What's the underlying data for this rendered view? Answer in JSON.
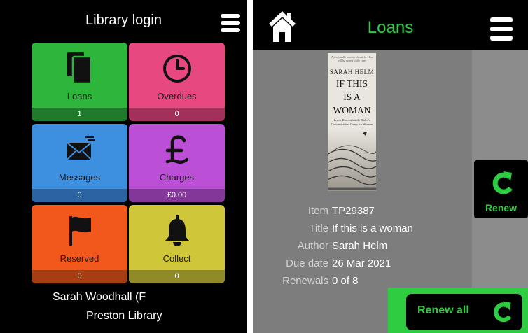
{
  "left_panel": {
    "title": "Library login",
    "tiles": {
      "loans": {
        "label": "Loans",
        "count": "1"
      },
      "overdues": {
        "label": "Overdues",
        "count": "0"
      },
      "messages": {
        "label": "Messages",
        "count": "0"
      },
      "charges": {
        "label": "Charges",
        "count": "£0.00"
      },
      "reserved": {
        "label": "Reserved",
        "count": "0"
      },
      "collect": {
        "label": "Collect",
        "count": "0"
      }
    },
    "user_name": "Sarah Woodhall (F",
    "library_name": "Preston Library"
  },
  "right_panel": {
    "title": "Loans",
    "cover": {
      "quote": "'A profoundly moving chronicle... You will be moved to the core'",
      "author": "SARAH HELM",
      "title_lines": [
        "IF THIS",
        "IS A",
        "WOMAN"
      ],
      "subtitle": "Inside Ravensbrück: Hitler's Concentration Camp for Women"
    },
    "renew_label": "Renew",
    "details": {
      "item": {
        "label": "Item",
        "value": "TP29387"
      },
      "title": {
        "label": "Title",
        "value": "If this is a woman"
      },
      "author": {
        "label": "Author",
        "value": "Sarah Helm"
      },
      "due_date": {
        "label": "Due date",
        "value": "26 Mar 2021"
      },
      "renewals": {
        "label": "Renewals",
        "value": "0 of 8"
      }
    },
    "renew_all_label": "Renew all"
  },
  "colors": {
    "accent_green": "#2ecc40",
    "loans": "#2db53c",
    "overdues": "#e84880",
    "messages": "#3d8fe0",
    "charges": "#bb4fd6",
    "reserved": "#f2581c",
    "collect": "#cfc63a"
  },
  "icons": [
    "menu-icon",
    "copy-icon",
    "clock-icon",
    "envelope-icon",
    "pound-icon",
    "flag-icon",
    "bell-icon",
    "home-icon",
    "refresh-icon"
  ]
}
